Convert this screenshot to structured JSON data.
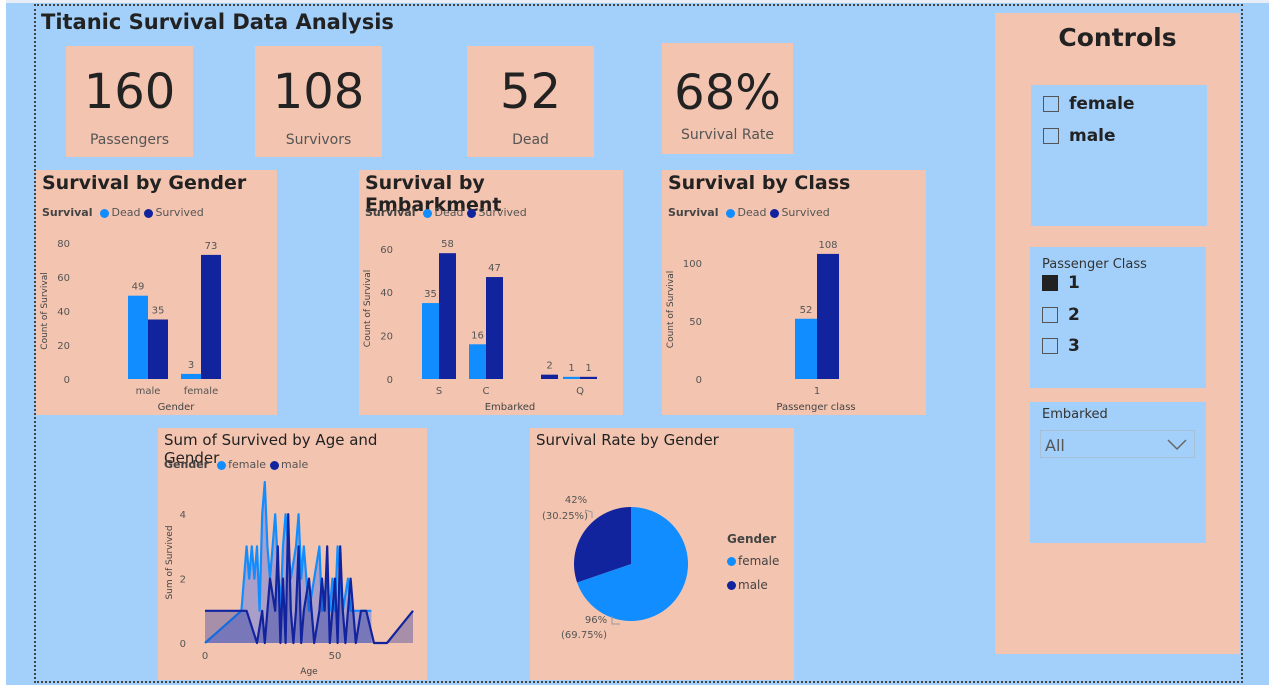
{
  "title": "Titanic Survival Data Analysis",
  "kpis": [
    {
      "value": "160",
      "label": "Passengers"
    },
    {
      "value": "108",
      "label": "Survivors"
    },
    {
      "value": "52",
      "label": "Dead"
    },
    {
      "value": "68%",
      "label": "Survival Rate"
    }
  ],
  "colors": {
    "dead": "#118dff",
    "survived": "#12239e",
    "panel": "#f3c4b0",
    "background": "#a3d0fb"
  },
  "legend_survival": {
    "title": "Survival",
    "dead": "Dead",
    "survived": "Survived"
  },
  "legend_gender": {
    "title": "Gender",
    "female": "female",
    "male": "male"
  },
  "charts": {
    "gender": {
      "title": "Survival by Gender",
      "xlabel": "Gender",
      "ylabel": "Count of Survival",
      "yticks": [
        "0",
        "20",
        "40",
        "60",
        "80"
      ]
    },
    "embark": {
      "title": "Survival by Embarkment",
      "xlabel": "Embarked",
      "ylabel": "Count of Survival",
      "yticks": [
        "0",
        "20",
        "40",
        "60"
      ]
    },
    "cls": {
      "title": "Survival by Class",
      "xlabel": "Passenger class",
      "ylabel": "Count of Survival",
      "yticks": [
        "0",
        "50",
        "100"
      ]
    },
    "age": {
      "title": "Sum of Survived by Age and Gender",
      "xlabel": "Age",
      "ylabel": "Sum of Survived",
      "yticks": [
        "0",
        "2",
        "4"
      ],
      "xticks": [
        "0",
        "50"
      ]
    },
    "pie": {
      "title": "Survival Rate by Gender",
      "label_male_pct": "42%",
      "label_male_share": "(30.25%)",
      "label_female_pct": "96%",
      "label_female_share": "(69.75%)"
    }
  },
  "chart_data": [
    {
      "type": "bar",
      "title": "Survival by Gender",
      "xlabel": "Gender",
      "ylabel": "Count of Survival",
      "ylim": [
        0,
        80
      ],
      "categories": [
        "male",
        "female"
      ],
      "series": [
        {
          "name": "Dead",
          "values": [
            49,
            3
          ]
        },
        {
          "name": "Survived",
          "values": [
            35,
            73
          ]
        }
      ]
    },
    {
      "type": "bar",
      "title": "Survival by Embarkment",
      "xlabel": "Embarked",
      "ylabel": "Count of Survival",
      "ylim": [
        0,
        65
      ],
      "categories": [
        "S",
        "C",
        "",
        "Q"
      ],
      "series": [
        {
          "name": "Dead",
          "values": [
            35,
            16,
            0,
            1
          ]
        },
        {
          "name": "Survived",
          "values": [
            58,
            47,
            2,
            1
          ]
        }
      ]
    },
    {
      "type": "bar",
      "title": "Survival by Class",
      "xlabel": "Passenger class",
      "ylabel": "Count of Survival",
      "ylim": [
        0,
        120
      ],
      "categories": [
        "1"
      ],
      "series": [
        {
          "name": "Dead",
          "values": [
            52
          ]
        },
        {
          "name": "Survived",
          "values": [
            108
          ]
        }
      ]
    },
    {
      "type": "area",
      "title": "Sum of Survived by Age and Gender",
      "xlabel": "Age",
      "ylabel": "Sum of Survived",
      "xlim": [
        0,
        80
      ],
      "ylim": [
        0,
        5
      ],
      "series": [
        {
          "name": "female",
          "x": [
            0,
            14,
            16,
            17,
            18,
            19,
            20,
            21,
            22,
            23,
            24,
            25,
            27,
            29,
            30,
            31,
            32,
            33,
            35,
            36,
            37,
            38,
            39,
            40,
            42,
            44,
            45,
            47,
            48,
            49,
            50,
            51,
            53,
            55,
            56,
            58,
            60,
            63,
            64
          ],
          "y": [
            0,
            1,
            3,
            2,
            3,
            2,
            3,
            1,
            4,
            5,
            3,
            2,
            4,
            1,
            3,
            4,
            3,
            2,
            3,
            4,
            2,
            3,
            2,
            1,
            2,
            3,
            1,
            2,
            1,
            2,
            1,
            3,
            1,
            2,
            1,
            1,
            1,
            1,
            1
          ]
        },
        {
          "name": "male",
          "x": [
            0,
            11,
            16,
            20,
            22,
            23,
            25,
            27,
            28,
            29,
            30,
            31,
            32,
            33,
            34,
            35,
            36,
            37,
            38,
            40,
            42,
            44,
            45,
            46,
            47,
            48,
            49,
            50,
            51,
            52,
            53,
            54,
            55,
            56,
            58,
            60,
            62,
            65,
            70,
            80
          ],
          "y": [
            1,
            1,
            1,
            0,
            1,
            0,
            2,
            1,
            3,
            0,
            2,
            0,
            4,
            1,
            0,
            1,
            3,
            0,
            1,
            2,
            0,
            1,
            2,
            1,
            3,
            0,
            1,
            2,
            0,
            3,
            1,
            0,
            1,
            2,
            0,
            1,
            1,
            0,
            0,
            1
          ]
        }
      ]
    },
    {
      "type": "pie",
      "title": "Survival Rate by Gender",
      "labels": [
        "female",
        "male"
      ],
      "values": [
        96,
        42
      ],
      "shares": [
        69.75,
        30.25
      ]
    }
  ],
  "controls": {
    "title": "Controls",
    "gender_options": [
      {
        "label": "female",
        "checked": false
      },
      {
        "label": "male",
        "checked": false
      }
    ],
    "class_slicer": {
      "header": "Passenger Class",
      "options": [
        {
          "label": "1",
          "checked": true
        },
        {
          "label": "2",
          "checked": false
        },
        {
          "label": "3",
          "checked": false
        }
      ]
    },
    "embarked_slicer": {
      "header": "Embarked",
      "selected": "All"
    }
  }
}
